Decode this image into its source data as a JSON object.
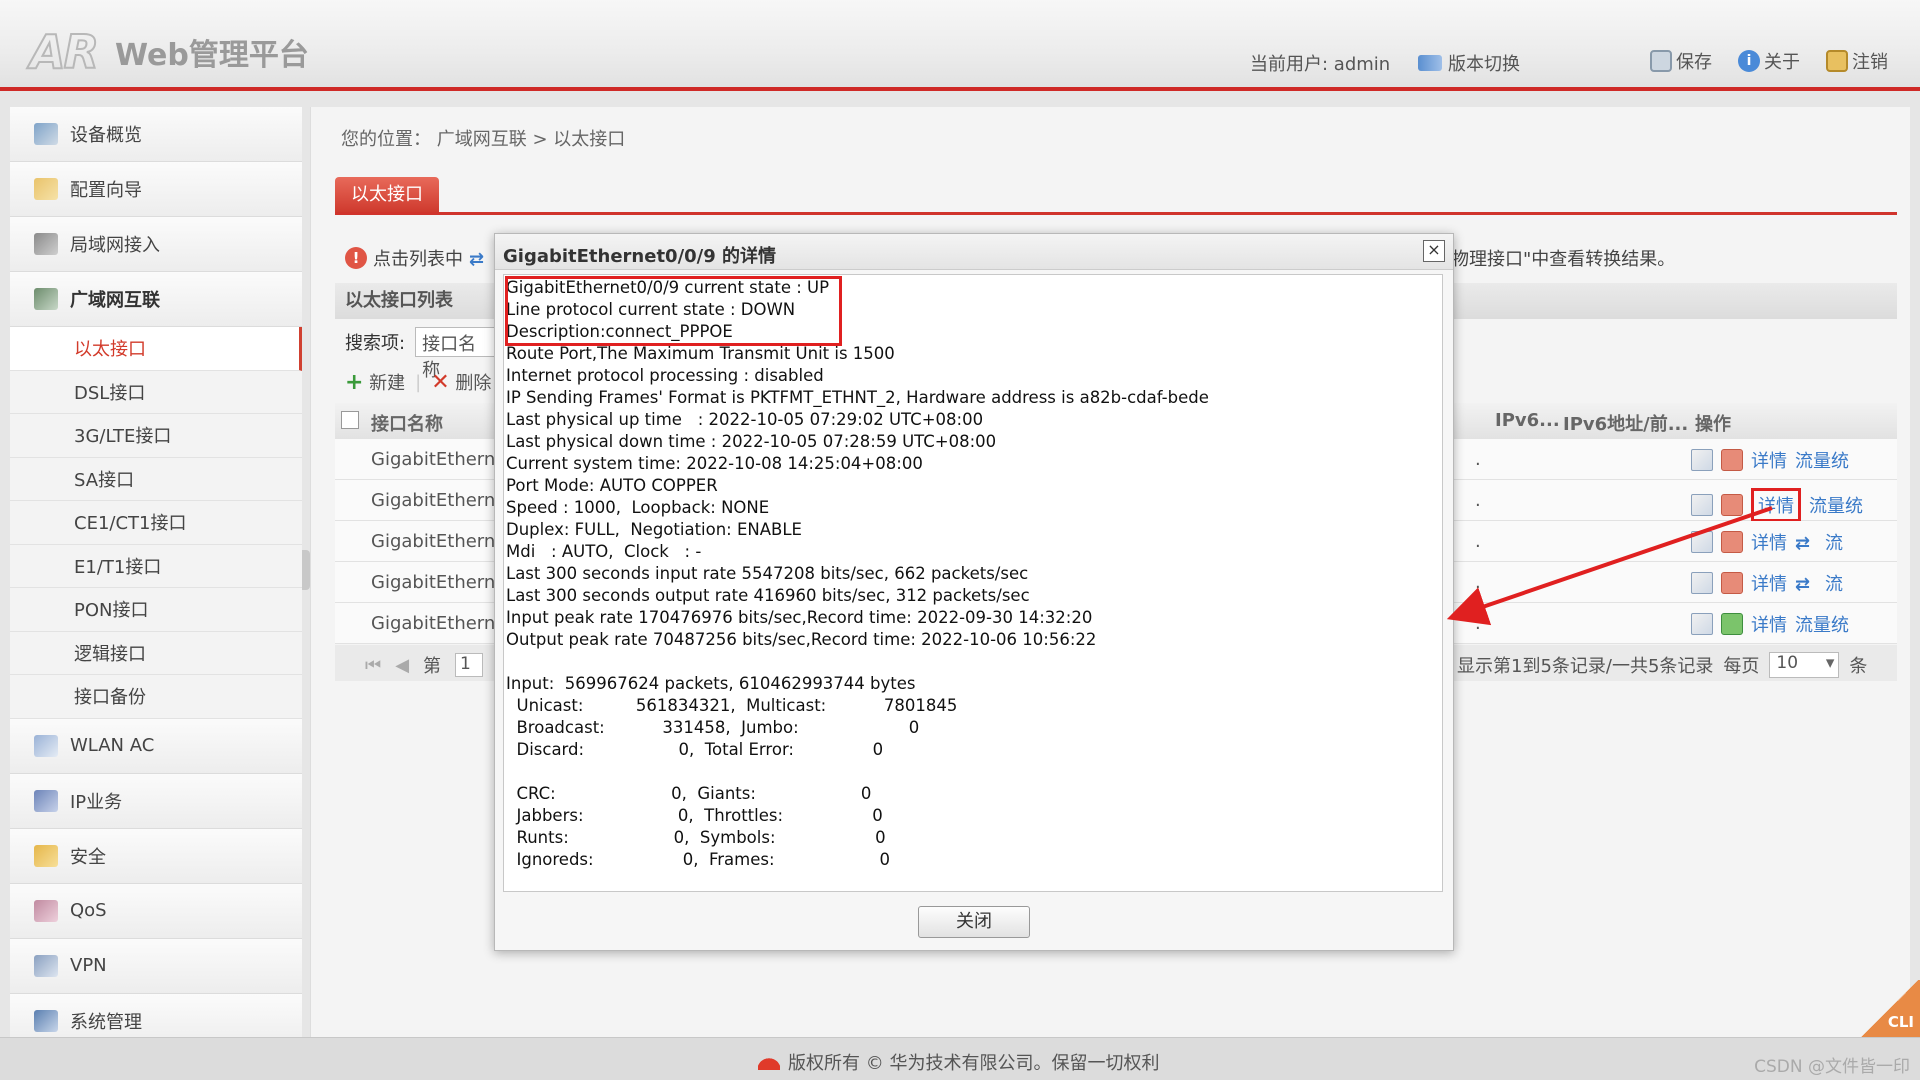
{
  "header": {
    "logo_mark": "AR",
    "logo_text": "Web管理平台",
    "current_user": "当前用户: admin",
    "version_switch": "版本切换",
    "save": "保存",
    "about": "关于",
    "logout": "注销"
  },
  "sidebar": {
    "items": [
      {
        "label": "设备概览",
        "icon": "device-overview-icon"
      },
      {
        "label": "配置向导",
        "icon": "config-wizard-icon"
      },
      {
        "label": "局域网接入",
        "icon": "lan-access-icon"
      },
      {
        "label": "广域网互联",
        "icon": "wan-icon"
      }
    ],
    "sub_items": [
      "以太接口",
      "DSL接口",
      "3G/LTE接口",
      "SA接口",
      "CE1/CT1接口",
      "E1/T1接口",
      "PON接口",
      "逻辑接口",
      "接口备份"
    ],
    "items_after": [
      {
        "label": "WLAN AC",
        "icon": "wlan-icon"
      },
      {
        "label": "IP业务",
        "icon": "ip-service-icon"
      },
      {
        "label": "安全",
        "icon": "security-shield-icon"
      },
      {
        "label": "QoS",
        "icon": "qos-icon"
      },
      {
        "label": "VPN",
        "icon": "vpn-icon"
      },
      {
        "label": "系统管理",
        "icon": "system-management-icon"
      }
    ]
  },
  "main": {
    "breadcrumb": "您的位置： 广域网互联 > 以太接口",
    "tab": "以太接口",
    "tip_start": "点击列表中",
    "tip_end": "物理接口\"中查看转换结果。",
    "panel_title": "以太接口列表",
    "search_label": "搜索项:",
    "search_value": "接口名称",
    "toolbar": {
      "new": "新建",
      "delete": "删除"
    },
    "columns": {
      "name": "接口名称",
      "ipv6": "IPv6...",
      "ipv6_addr": "IPv6地址/前...",
      "op": "操作"
    },
    "rows": [
      {
        "name": "GigabitEthernet",
        "detail": "详情",
        "traffic": "流量统",
        "state": "stop"
      },
      {
        "name": "GigabitEthernet",
        "detail": "详情",
        "traffic": "流量统",
        "state": "stop"
      },
      {
        "name": "GigabitEthernet",
        "detail": "详情",
        "traffic": "流",
        "state": "stop"
      },
      {
        "name": "GigabitEthernet",
        "detail": "详情",
        "traffic": "流",
        "state": "stop"
      },
      {
        "name": "GigabitEthernet",
        "detail": "详情",
        "traffic": "流量统",
        "state": "start"
      }
    ],
    "pager": {
      "page_prefix": "第",
      "page": "1",
      "summary": "显示第1到5条记录/一共5条记录",
      "per_page_label": "每页",
      "per_page": "10",
      "unit": "条"
    }
  },
  "modal": {
    "title": "GigabitEthernet0/0/9 的详情",
    "close_label": "×",
    "lines": [
      "GigabitEthernet0/0/9 current state : UP",
      "Line protocol current state : DOWN",
      "Description:connect_PPPOE",
      "Route Port,The Maximum Transmit Unit is 1500",
      "Internet protocol processing : disabled",
      "IP Sending Frames' Format is PKTFMT_ETHNT_2, Hardware address is a82b-cdaf-bede",
      "Last physical up time   : 2022-10-05 07:29:02 UTC+08:00",
      "Last physical down time : 2022-10-05 07:28:59 UTC+08:00",
      "Current system time: 2022-10-08 14:25:04+08:00",
      "Port Mode: AUTO COPPER",
      "Speed : 1000,  Loopback: NONE",
      "Duplex: FULL,  Negotiation: ENABLE",
      "Mdi   : AUTO,  Clock   : -",
      "Last 300 seconds input rate 5547208 bits/sec, 662 packets/sec",
      "Last 300 seconds output rate 416960 bits/sec, 312 packets/sec",
      "Input peak rate 170476976 bits/sec,Record time: 2022-09-30 14:32:20",
      "Output peak rate 70487256 bits/sec,Record time: 2022-10-06 10:56:22",
      "",
      "Input:  569967624 packets, 610462993744 bytes",
      "  Unicast:          561834321,  Multicast:           7801845",
      "  Broadcast:           331458,  Jumbo:                     0",
      "  Discard:                  0,  Total Error:               0",
      "",
      "  CRC:                      0,  Giants:                    0",
      "  Jabbers:                  0,  Throttles:                 0",
      "  Runts:                    0,  Symbols:                   0",
      "  Ignoreds:                 0,  Frames:                    0"
    ],
    "close_button": "关闭"
  },
  "footer": {
    "copyright": "版权所有 © 华为技术有限公司。保留一切权利",
    "watermark": "CSDN @文件皆一印",
    "cli": "CLI"
  }
}
